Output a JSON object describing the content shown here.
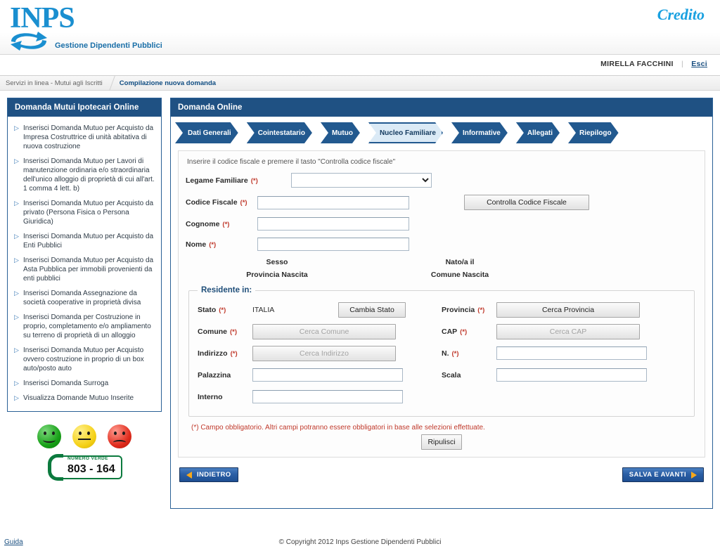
{
  "header": {
    "logo_text": "INPS",
    "logo_icon": "swirl-arrows-icon",
    "tagline": "Gestione Dipendenti Pubblici",
    "app_label": "Credito"
  },
  "userbar": {
    "user_name": "MIRELLA FACCHINI",
    "logout_label": "Esci"
  },
  "breadcrumb": {
    "parent": "Servizi in linea - Mutui agli Iscritti",
    "current": "Compilazione nuova domanda"
  },
  "sidebar": {
    "title": "Domanda Mutui Ipotecari Online",
    "items": [
      {
        "label": "Inserisci Domanda Mutuo per Acquisto da Impresa Costruttrice di unità abitativa di nuova costruzione"
      },
      {
        "label": "Inserisci Domanda Mutuo per Lavori di manutenzione ordinaria e/o straordinaria dell'unico alloggio di proprietà di cui all'art. 1 comma 4 lett. b)"
      },
      {
        "label": "Inserisci Domanda Mutuo per Acquisto da privato (Persona Fisica o Persona Giuridica)"
      },
      {
        "label": "Inserisci Domanda Mutuo per Acquisto da Enti Pubblici"
      },
      {
        "label": "Inserisci Domanda Mutuo per Acquisto da Asta Pubblica per immobili provenienti da enti pubblici"
      },
      {
        "label": "Inserisci Domanda Assegnazione da società cooperative in proprietà divisa"
      },
      {
        "label": "Inserisci Domanda per Costruzione in proprio, completamento e/o ampliamento su terreno di proprietà di un alloggio"
      },
      {
        "label": "Inserisci Domanda Mutuo per Acquisto ovvero costruzione in proprio di un box auto/posto auto"
      },
      {
        "label": "Inserisci Domanda Surroga"
      },
      {
        "label": "Visualizza Domande Mutuo Inserite"
      }
    ],
    "feedback": {
      "positive": "smiley-happy-icon",
      "neutral": "smiley-neutral-icon",
      "negative": "smiley-sad-icon"
    },
    "green_number": {
      "caption": "NUMERO VERDE",
      "number": "803 - 164",
      "icon": "phone-handset-icon"
    }
  },
  "panel": {
    "title": "Domanda Online",
    "steps": [
      {
        "label": "Dati Generali",
        "active": false
      },
      {
        "label": "Cointestatario",
        "active": false
      },
      {
        "label": "Mutuo",
        "active": false
      },
      {
        "label": "Nucleo Familiare",
        "active": true
      },
      {
        "label": "Informative",
        "active": false
      },
      {
        "label": "Allegati",
        "active": false
      },
      {
        "label": "Riepilogo",
        "active": false
      }
    ],
    "hint": "Inserire il codice fiscale e premere il tasto \"Controlla codice fiscale\"",
    "fields": {
      "legame_familiare": {
        "label": "Legame Familiare",
        "required": "(*)",
        "value": "",
        "options": [
          ""
        ]
      },
      "codice_fiscale": {
        "label": "Codice Fiscale",
        "required": "(*)",
        "value": ""
      },
      "cognome": {
        "label": "Cognome",
        "required": "(*)",
        "value": ""
      },
      "nome": {
        "label": "Nome",
        "required": "(*)",
        "value": ""
      }
    },
    "check_cf_button": "Controlla Codice Fiscale",
    "readonly": {
      "sesso_label": "Sesso",
      "sesso_value": "",
      "nato_label": "Nato/a il",
      "nato_value": "",
      "provincia_nascita_label": "Provincia Nascita",
      "provincia_nascita_value": "",
      "comune_nascita_label": "Comune Nascita",
      "comune_nascita_value": ""
    },
    "residente": {
      "legend": "Residente in:",
      "stato": {
        "label": "Stato",
        "required": "(*)",
        "value": "ITALIA",
        "button": "Cambia Stato"
      },
      "comune": {
        "label": "Comune",
        "required": "(*)",
        "button": "Cerca Comune",
        "disabled": true
      },
      "indirizzo": {
        "label": "Indirizzo",
        "required": "(*)",
        "button": "Cerca Indirizzo",
        "disabled": true
      },
      "palazzina": {
        "label": "Palazzina",
        "required": "",
        "value": ""
      },
      "interno": {
        "label": "Interno",
        "required": "",
        "value": ""
      },
      "provincia": {
        "label": "Provincia",
        "required": "(*)",
        "button": "Cerca Provincia",
        "disabled": false
      },
      "cap": {
        "label": "CAP",
        "required": "(*)",
        "button": "Cerca CAP",
        "disabled": true
      },
      "numero": {
        "label": "N.",
        "required": "(*)",
        "value": ""
      },
      "scala": {
        "label": "Scala",
        "required": "",
        "value": ""
      }
    },
    "footnote": "(*) Campo obbligatorio. Altri campi potranno essere obbligatori in base alle selezioni effettuate.",
    "clear_button": "Ripulisci",
    "back_button": "INDIETRO",
    "next_button": "SALVA E AVANTI"
  },
  "footer": {
    "guida": "Guida",
    "copyright": "© Copyright 2012 Inps Gestione Dipendenti Pubblici"
  },
  "colors": {
    "brand_blue": "#1f5183",
    "logo_blue": "#1a8fd0",
    "accent_orange": "#f7a81b",
    "required_red": "#c0392b",
    "green": "#0c7a3e"
  }
}
